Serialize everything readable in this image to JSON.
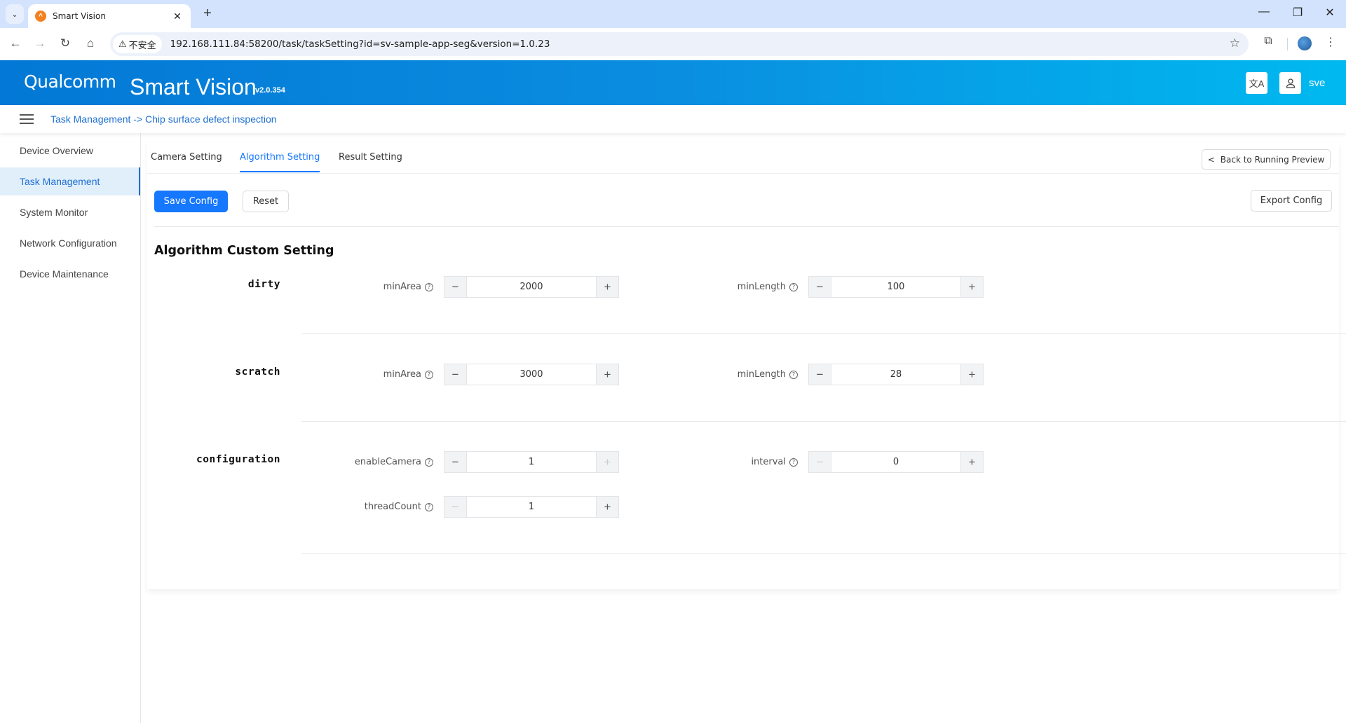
{
  "browser": {
    "tab_title": "Smart Vision",
    "security_label": "不安全",
    "url": "192.168.111.84:58200/task/taskSetting?id=sv-sample-app-seg&version=1.0.23"
  },
  "header": {
    "logo": "Qualcomm",
    "title": "Smart Vision",
    "version": "v2.0.354",
    "user": "sve"
  },
  "breadcrumb": "Task Management -> Chip surface defect inspection",
  "sidebar": {
    "items": [
      {
        "label": "Device Overview"
      },
      {
        "label": "Task Management",
        "active": true
      },
      {
        "label": "System Monitor"
      },
      {
        "label": "Network Configuration"
      },
      {
        "label": "Device Maintenance"
      }
    ]
  },
  "tabs": [
    {
      "label": "Camera Setting"
    },
    {
      "label": "Algorithm Setting",
      "active": true
    },
    {
      "label": "Result Setting"
    }
  ],
  "actions": {
    "back": "Back to Running Preview",
    "save": "Save Config",
    "reset": "Reset",
    "export": "Export Config"
  },
  "section_title": "Algorithm Custom Setting",
  "groups": [
    {
      "name": "dirty",
      "fields": [
        {
          "label": "minArea",
          "value": "2000"
        },
        {
          "label": "minLength",
          "value": "100"
        }
      ]
    },
    {
      "name": "scratch",
      "fields": [
        {
          "label": "minArea",
          "value": "3000"
        },
        {
          "label": "minLength",
          "value": "28"
        }
      ]
    },
    {
      "name": "configuration",
      "fields": [
        {
          "label": "enableCamera",
          "value": "1",
          "plus_disabled": true
        },
        {
          "label": "interval",
          "value": "0",
          "minus_disabled": true
        },
        {
          "label": "threadCount",
          "value": "1",
          "minus_disabled": true
        }
      ]
    }
  ]
}
